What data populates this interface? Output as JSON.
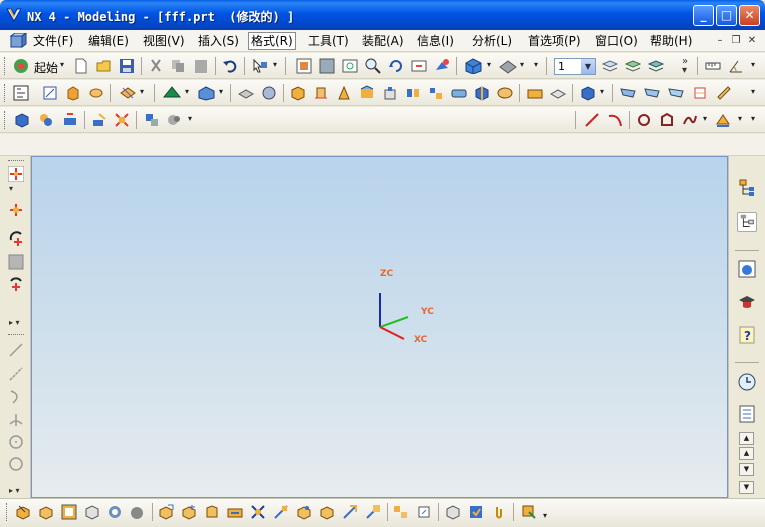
{
  "window": {
    "title": "NX 4 - Modeling - [fff.prt  (修改的) ]",
    "controls": {
      "minimize": "_",
      "maximize": "□",
      "close": "✕"
    }
  },
  "menubar": {
    "items": [
      {
        "label": "文件(F)"
      },
      {
        "label": "编辑(E)"
      },
      {
        "label": "视图(V)"
      },
      {
        "label": "插入(S)"
      },
      {
        "label": "格式(R)",
        "active": true
      },
      {
        "label": "工具(T)"
      },
      {
        "label": "装配(A)"
      },
      {
        "label": "信息(I)"
      },
      {
        "label": "分析(L)"
      },
      {
        "label": "首选项(P)"
      },
      {
        "label": "窗口(O)"
      },
      {
        "label": "帮助(H)"
      }
    ],
    "mdi_controls": {
      "minimize": "–",
      "restore": "❐",
      "close": "✕"
    }
  },
  "toolbar": {
    "start_label": "起始",
    "layer_value": "1"
  },
  "graphics": {
    "axes": {
      "z_label": "ZC",
      "y_label": "YC",
      "x_label": "XC"
    },
    "colors": {
      "x": "#e02020",
      "y": "#20c020",
      "z": "#1a2aa8",
      "label": "#e8662a"
    }
  },
  "icons": {
    "app": "nx-logo-icon",
    "new": "new-file-icon",
    "open": "open-folder-icon",
    "save": "save-icon",
    "undo": "undo-icon"
  }
}
